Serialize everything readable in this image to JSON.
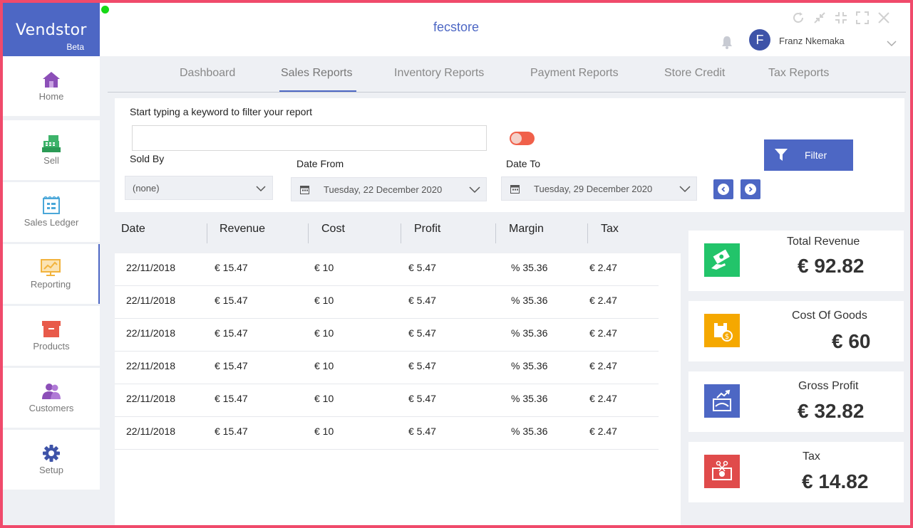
{
  "app": {
    "name": "Vendstor",
    "edition": "Beta",
    "store": "fecstore"
  },
  "user": {
    "initial": "F",
    "name": "Franz Nkemaka"
  },
  "window_controls": [
    "refresh-icon",
    "collapse-icon",
    "compress-icon",
    "expand-icon",
    "close-icon"
  ],
  "sidebar": {
    "items": [
      {
        "label": "Home",
        "icon": "home-icon",
        "color": "#8c4fb8"
      },
      {
        "label": "Sell",
        "icon": "cash-register-icon",
        "color": "#3db36a"
      },
      {
        "label": "Sales Ledger",
        "icon": "ledger-icon",
        "color": "#4aa7d9"
      },
      {
        "label": "Reporting",
        "icon": "chart-board-icon",
        "color": "#f2b33d"
      },
      {
        "label": "Products",
        "icon": "box-icon",
        "color": "#e85a4a"
      },
      {
        "label": "Customers",
        "icon": "customers-icon",
        "color": "#8c4fb8"
      },
      {
        "label": "Setup",
        "icon": "gear-icon",
        "color": "#3e53a8"
      }
    ],
    "active": "Reporting"
  },
  "tabs": [
    {
      "label": "Dashboard"
    },
    {
      "label": "Sales Reports"
    },
    {
      "label": "Inventory Reports"
    },
    {
      "label": "Payment Reports"
    },
    {
      "label": "Store Credit"
    },
    {
      "label": "Tax Reports"
    }
  ],
  "active_tab": "Sales Reports",
  "filter": {
    "keyword_label": "Start typing a keyword to filter your report",
    "keyword_value": "",
    "sold_by_label": "Sold By",
    "sold_by_value": "(none)",
    "date_from_label": "Date From",
    "date_from_value": "Tuesday, 22 December 2020",
    "date_to_label": "Date To",
    "date_to_value": "Tuesday, 29 December 2020",
    "button_label": "Filter",
    "toggle_on": true
  },
  "table": {
    "headers": [
      "Date",
      "Revenue",
      "Cost",
      "Profit",
      "Margin",
      "Tax"
    ],
    "rows": [
      [
        "22/11/2018",
        "€ 15.47",
        "€ 10",
        "€ 5.47",
        "% 35.36",
        "€ 2.47"
      ],
      [
        "22/11/2018",
        "€ 15.47",
        "€ 10",
        "€ 5.47",
        "% 35.36",
        "€ 2.47"
      ],
      [
        "22/11/2018",
        "€ 15.47",
        "€ 10",
        "€ 5.47",
        "% 35.36",
        "€ 2.47"
      ],
      [
        "22/11/2018",
        "€ 15.47",
        "€ 10",
        "€ 5.47",
        "% 35.36",
        "€ 2.47"
      ],
      [
        "22/11/2018",
        "€ 15.47",
        "€ 10",
        "€ 5.47",
        "% 35.36",
        "€ 2.47"
      ],
      [
        "22/11/2018",
        "€ 15.47",
        "€ 10",
        "€ 5.47",
        "% 35.36",
        "€ 2.47"
      ]
    ]
  },
  "summary": [
    {
      "title": "Total Revenue",
      "amount": "€ 92.82",
      "icon": "money-hand-icon",
      "color": "#22c46a"
    },
    {
      "title": "Cost Of Goods",
      "amount": "€ 60",
      "icon": "box-dollar-icon",
      "color": "#f5a800"
    },
    {
      "title": "Gross Profit",
      "amount": "€ 32.82",
      "icon": "profit-chart-icon",
      "color": "#4d67c4"
    },
    {
      "title": "Tax",
      "amount": "€ 14.82",
      "icon": "tax-cut-icon",
      "color": "#e04b4b"
    }
  ],
  "colors": {
    "brand": "#4d67c4",
    "frame": "#f04a6b",
    "background": "#eef0f4"
  }
}
